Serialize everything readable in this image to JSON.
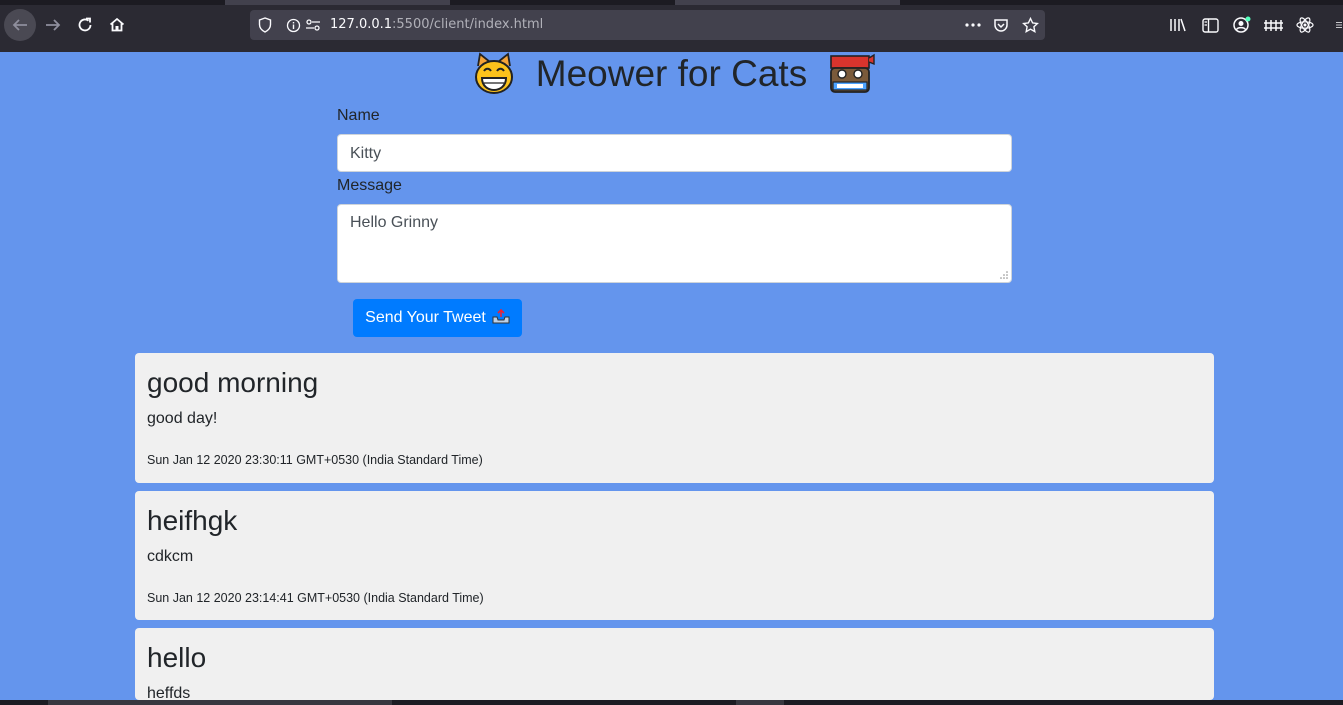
{
  "browser": {
    "url_host": "127.0.0.1",
    "url_rest": ":5500/client/index.html"
  },
  "page": {
    "title": "Meower for Cats",
    "title_left_icon": "grinning-cat-emoji",
    "title_right_icon": "ninja-cat-emoji"
  },
  "form": {
    "name_label": "Name",
    "name_value": "Kitty",
    "message_label": "Message",
    "message_value": "Hello Grinny",
    "send_label": "Send Your Tweet",
    "send_icon": "outbox-tray-emoji"
  },
  "tweets": [
    {
      "name": "good morning",
      "message": "good day!",
      "date": "Sun Jan 12 2020 23:30:11 GMT+0530 (India Standard Time)"
    },
    {
      "name": "heifhgk",
      "message": "cdkcm",
      "date": "Sun Jan 12 2020 23:14:41 GMT+0530 (India Standard Time)"
    },
    {
      "name": "hello",
      "message": "heffds",
      "date": ""
    }
  ],
  "colors": {
    "page_bg": "#6495ed",
    "button_bg": "#007bff",
    "card_bg": "#f0f0f0",
    "toolbar_bg": "#2b2a33"
  }
}
